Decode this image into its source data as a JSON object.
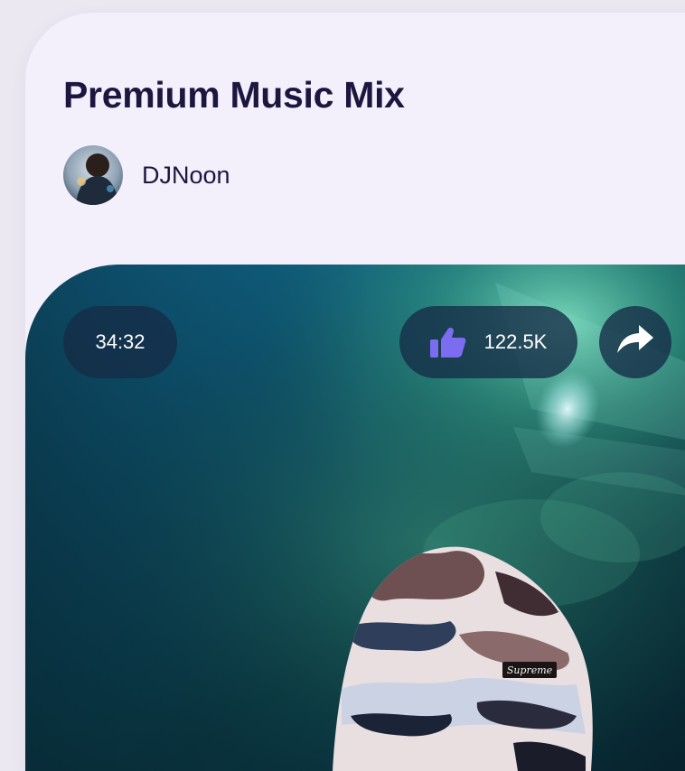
{
  "card": {
    "title": "Premium Music Mix",
    "author": {
      "name": "DJNoon",
      "avatar_icon": "avatar-photo"
    }
  },
  "media": {
    "duration": "34:32",
    "likes": "122.5K",
    "like_icon": "thumbs-up-icon",
    "share_icon": "share-arrow-icon",
    "hat_label": "Supreme"
  },
  "colors": {
    "page_background": "#ebe8f2",
    "card_background": "#f3f0fb",
    "title_text": "#1d1740",
    "pill_background": "#162c46",
    "pill_text": "#ffffff",
    "like_accent": "#7b6cf0"
  }
}
